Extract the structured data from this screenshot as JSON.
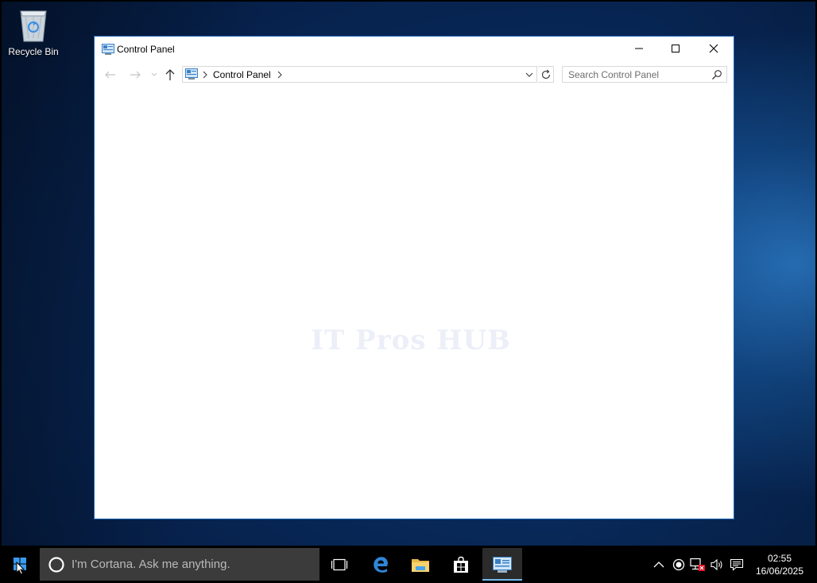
{
  "desktop": {
    "icons": [
      {
        "label": "Recycle Bin",
        "icon": "recycle-bin-icon"
      }
    ]
  },
  "window": {
    "title": "Control Panel",
    "icon": "control-panel-icon",
    "controls": [
      "minimize-icon",
      "maximize-icon",
      "close-icon"
    ],
    "address": {
      "breadcrumbs": [
        "Control Panel"
      ]
    },
    "search": {
      "placeholder": "Search Control Panel",
      "value": ""
    },
    "watermark": "IT Pros HUB"
  },
  "taskbar": {
    "cortana": {
      "placeholder": "I'm Cortana. Ask me anything."
    },
    "pinned": [
      "task-view-icon",
      "edge-icon",
      "file-explorer-icon",
      "store-icon",
      "control-panel-icon"
    ],
    "active": "control-panel-icon",
    "tray": [
      "show-hidden-icons-chevron",
      "record-icon",
      "network-disconnected-icon",
      "volume-icon",
      "action-center-icon"
    ],
    "clock": {
      "time": "02:55",
      "date": "16/06/2025"
    }
  },
  "colors": {
    "window_border": "#1f66b5",
    "taskbar": "#000000",
    "cortana_box": "#3b3b3b",
    "active_indicator": "#76b9ed"
  }
}
